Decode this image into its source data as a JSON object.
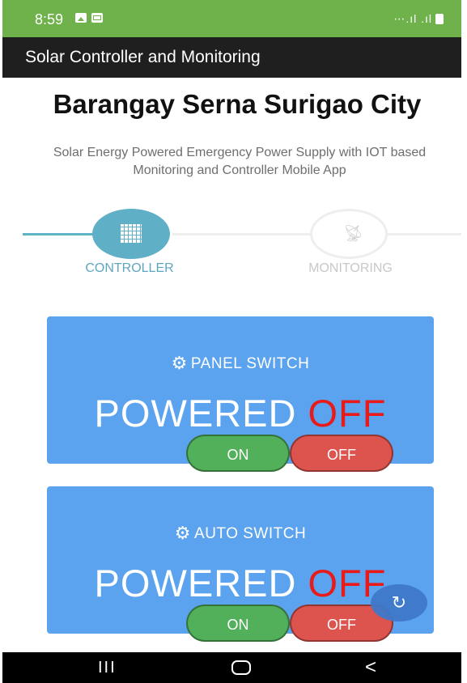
{
  "status_bar": {
    "time": "8:59",
    "icons": [
      "gallery-icon",
      "message-icon",
      "wifi-icon",
      "signal-icon",
      "signal-icon",
      "battery-icon"
    ],
    "right_text": "⋯.ıl .ıl"
  },
  "app_bar": {
    "title": "Solar Controller and Monitoring"
  },
  "header": {
    "title": "Barangay Serna Surigao City",
    "subtitle": "Solar Energy Powered Emergency Power Supply with IOT based Monitoring and Controller Mobile App"
  },
  "stepper": {
    "steps": [
      {
        "label": "CONTROLLER",
        "icon": "grid-icon",
        "active": true
      },
      {
        "label": "MONITORING",
        "icon": "antenna-icon",
        "active": false
      }
    ],
    "active_color": "#5fafc7"
  },
  "cards": [
    {
      "title": "PANEL SWITCH",
      "state_prefix": "POWERED",
      "state_value": "OFF",
      "on_label": "ON",
      "off_label": "OFF"
    },
    {
      "title": "AUTO SWITCH",
      "state_prefix": "POWERED",
      "state_value": "OFF",
      "on_label": "ON",
      "off_label": "OFF"
    }
  ],
  "colors": {
    "status_bar": "#6fb24b",
    "app_bar": "#1f1f1f",
    "card": "#5ba3ee",
    "off_text": "#e81a1a",
    "on_button": "#52b05a",
    "off_button": "#dd534d"
  },
  "fab": {
    "icon": "refresh-icon"
  },
  "nav_bar": {
    "recent_glyph": "III",
    "back_glyph": "<"
  }
}
